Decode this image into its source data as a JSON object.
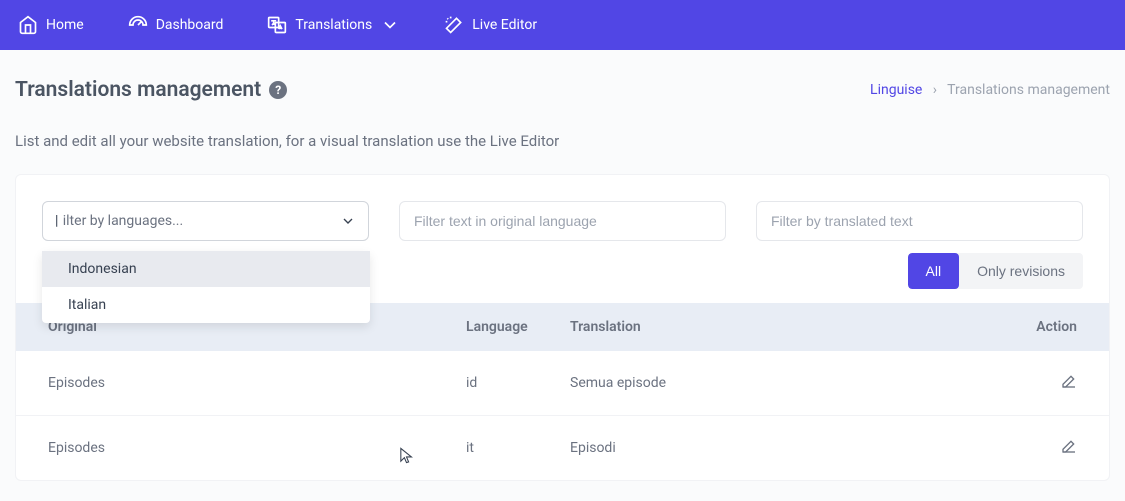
{
  "nav": {
    "home": "Home",
    "dashboard": "Dashboard",
    "translations": "Translations",
    "live_editor": "Live Editor"
  },
  "page": {
    "title": "Translations management",
    "subtitle": "List and edit all your website translation, for a visual translation use the Live Editor"
  },
  "breadcrumb": {
    "root": "Linguise",
    "sep": "›",
    "current": "Translations management"
  },
  "filters": {
    "language_placeholder": "Filter by languages...",
    "original_placeholder": "Filter text in original language",
    "translated_placeholder": "Filter by translated text",
    "dropdown": [
      "Indonesian",
      "Italian"
    ]
  },
  "toggle": {
    "all": "All",
    "revisions": "Only revisions"
  },
  "table": {
    "headers": {
      "original": "Original",
      "language": "Language",
      "translation": "Translation",
      "action": "Action"
    },
    "rows": [
      {
        "original": "Episodes",
        "language": "id",
        "translation": "Semua episode"
      },
      {
        "original": "Episodes",
        "language": "it",
        "translation": "Episodi"
      }
    ]
  }
}
